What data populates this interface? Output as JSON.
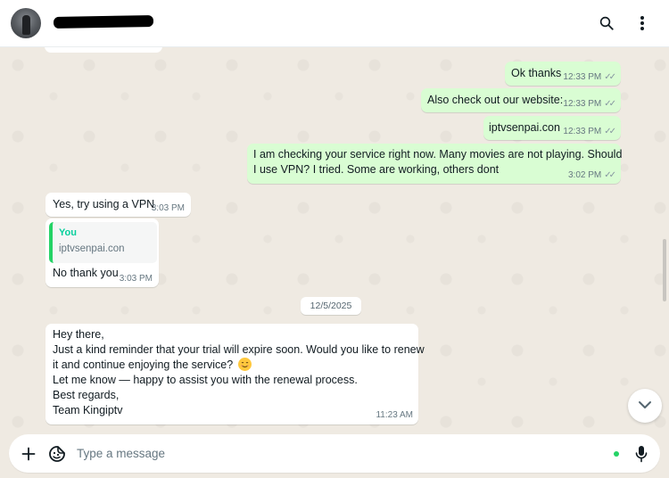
{
  "header": {
    "contact_name_redacted": true
  },
  "messages": [
    {
      "id": "m1",
      "direction": "out",
      "text": "Ok thanks",
      "time": "12:33 PM",
      "status": "read"
    },
    {
      "id": "m2",
      "direction": "out",
      "text": "Also check out our website:",
      "time": "12:33 PM",
      "status": "read"
    },
    {
      "id": "m3",
      "direction": "out",
      "text": "iptvsenpai.con",
      "time": "12:33 PM",
      "status": "read"
    },
    {
      "id": "m4",
      "direction": "out",
      "lines": [
        "I am checking your service right now. Many movies are not playing. Should",
        "I use VPN? I tried. Some are working, others dont"
      ],
      "time": "3:02 PM",
      "status": "read"
    },
    {
      "id": "m5",
      "direction": "in",
      "text": "Yes, try using a VPN",
      "time": "3:03 PM"
    },
    {
      "id": "m6",
      "direction": "in",
      "quote": {
        "author": "You",
        "text": "iptvsenpai.con"
      },
      "text": "No thank you",
      "time": "3:03 PM"
    },
    {
      "id": "m7",
      "direction": "in",
      "lines": [
        "Hey there,",
        "Just a kind reminder that your trial will expire soon. Would you like to renew",
        "it and continue enjoying the service?",
        "Let me know — happy to assist you with the renewal process.",
        "Best regards,",
        "Team Kingiptv"
      ],
      "time": "11:23 AM"
    }
  ],
  "date_divider": "12/5/2025",
  "composer": {
    "placeholder": "Type a message"
  },
  "icons": {
    "search": "search-icon",
    "menu": "kebab-menu-icon",
    "plus": "plus-icon",
    "sticker": "sticker-icon",
    "mic": "microphone-icon",
    "scroll_down": "chevron-down-icon",
    "read_ticks": "double-check-icon",
    "emoji": "smiling-face-emoji"
  },
  "colors": {
    "outgoing_bubble": "#d9fdd3",
    "incoming_bubble": "#ffffff",
    "accent_green": "#25d366",
    "quote_author": "#06cf9c",
    "chat_background": "#efeae2"
  }
}
